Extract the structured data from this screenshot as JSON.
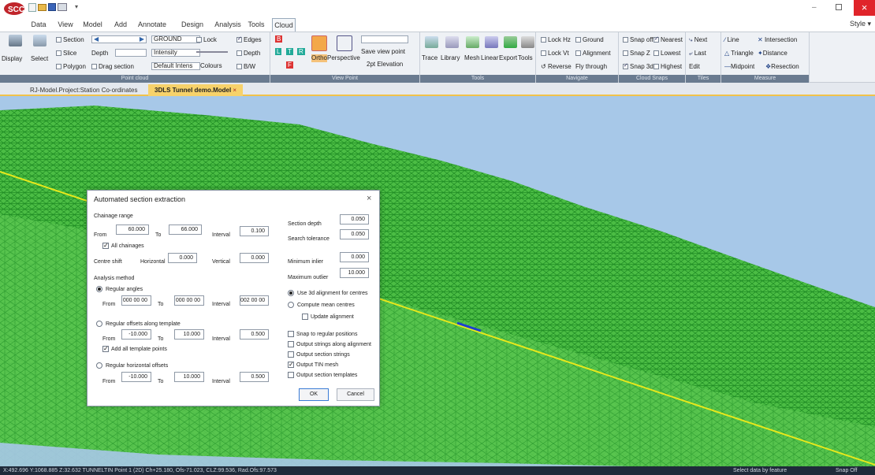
{
  "window": {
    "style_label": "Style ▾"
  },
  "menu": {
    "tabs": [
      "Data",
      "View",
      "Model",
      "Add",
      "Annotate",
      "Design",
      "Analysis",
      "Tools",
      "Cloud"
    ],
    "active": "Cloud"
  },
  "ribbon": {
    "point_cloud": {
      "label": "Point cloud",
      "display": "Display",
      "select": "Select",
      "section": "Section",
      "slice": "Slice",
      "polygon": "Polygon",
      "depth_label": "Depth",
      "drag_section": "Drag section",
      "ground_value": "GROUND",
      "intensity_value": "Intensity",
      "default_intens": "Default Intens",
      "lock": "Lock",
      "colours": "Colours",
      "edges": "Edges",
      "depth": "Depth",
      "bw": "B/W"
    },
    "view_point": {
      "label": "View Point",
      "b": "B",
      "l": "L",
      "t": "T",
      "r": "R",
      "f": "F",
      "ortho": "Ortho",
      "perspective": "Perspective",
      "save_view_point": "Save view point",
      "elevation": "2pt Elevation"
    },
    "tools": {
      "label": "Tools",
      "items": [
        "Trace",
        "Library",
        "Mesh",
        "Linear",
        "Export",
        "Tools"
      ]
    },
    "navigate": {
      "label": "Navigate",
      "lock_hz": "Lock Hz",
      "ground": "Ground",
      "lock_vt": "Lock Vt",
      "alignment": "Alignment",
      "reverse": "Reverse",
      "fly_through": "Fly through"
    },
    "cloud_snaps": {
      "label": "Cloud Snaps",
      "snap_off": "Snap off",
      "nearest": "Nearest",
      "snap_z": "Snap Z",
      "lowest": "Lowest",
      "snap_3d": "Snap 3d",
      "highest": "Highest"
    },
    "tiles": {
      "label": "Tiles",
      "next": "Next",
      "last": "Last",
      "edit": "Edit"
    },
    "measure": {
      "label": "Measure",
      "line": "Line",
      "intersection": "Intersection",
      "triangle": "Triangle",
      "distance": "Distance",
      "midpoint": "Midpoint",
      "resection": "Resection"
    }
  },
  "doc_tabs": [
    {
      "label": "RJ-Model.Project:Station Co-ordinates"
    },
    {
      "label": "3DLS Tunnel demo.Model"
    }
  ],
  "dialog": {
    "title": "Automated section extraction",
    "chainage_range": "Chainage range",
    "from": "From",
    "to": "To",
    "interval": "Interval",
    "ch_from": "60.000",
    "ch_to": "66.000",
    "ch_interval": "0.100",
    "all_chainages": "All chainages",
    "centre_shift": "Centre shift",
    "horizontal": "Horizontal",
    "vertical": "Vertical",
    "horiz_val": "0.000",
    "vert_val": "0.000",
    "analysis_method": "Analysis method",
    "regular_angles": "Regular angles",
    "ang_from": "000 00 00",
    "ang_to": "000 00 00",
    "ang_interval": "002 00 00",
    "regular_offsets": "Regular offsets along template",
    "off_from": "-10.000",
    "off_to": "10.000",
    "off_interval": "0.500",
    "add_template_points": "Add all template points",
    "regular_horiz": "Regular horizontal offsets",
    "hz_from": "-10.000",
    "hz_to": "10.000",
    "hz_interval": "0.500",
    "section_depth": "Section depth",
    "section_depth_val": "0.050",
    "search_tolerance": "Search tolerance",
    "search_tolerance_val": "0.050",
    "minimum_inlier": "Minimum inlier",
    "minimum_inlier_val": "0.000",
    "maximum_outlier": "Maximum outlier",
    "maximum_outlier_val": "10.000",
    "use_3d_alignment": "Use 3d alignment for centres",
    "compute_mean": "Compute mean centres",
    "update_alignment": "Update alignment",
    "snap_regular": "Snap to regular positions",
    "output_strings_alignment": "Output strings along alignment",
    "output_section_strings": "Output section strings",
    "output_tin": "Output TIN mesh",
    "output_templates": "Output section templates",
    "ok": "OK",
    "cancel": "Cancel"
  },
  "status": {
    "coords": "X:492.696 Y:1068.885 Z:32.632  TUNNELTIN  Point 1  (2D)  Ch+25.180, Ofs-71.023, CLZ:99.536, Rad.Ofs:97.573",
    "hint": "Select data by feature",
    "snap": "Snap Off"
  }
}
